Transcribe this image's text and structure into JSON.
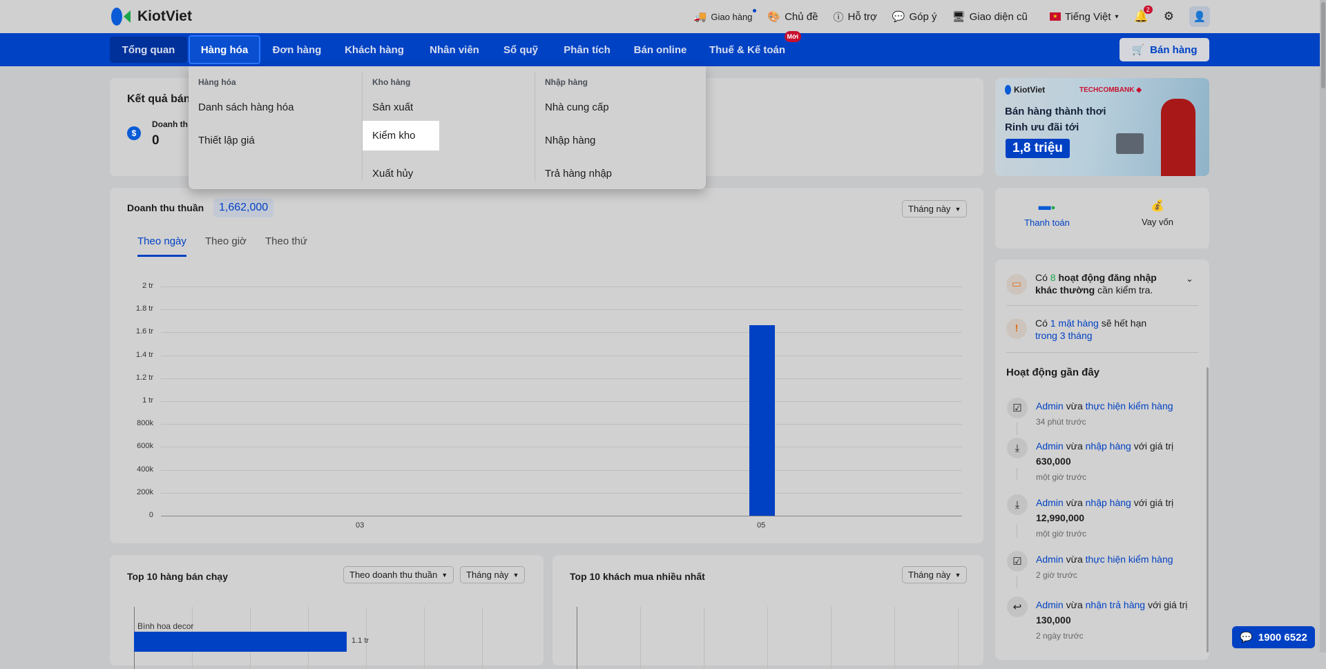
{
  "header": {
    "brand": "KiotViet",
    "links": [
      {
        "label": "Giao hàng",
        "icon": "truck-icon"
      },
      {
        "label": "Chủ đề",
        "icon": "palette-icon"
      },
      {
        "label": "Hỗ trợ",
        "icon": "help-icon"
      },
      {
        "label": "Góp ý",
        "icon": "feedback-icon"
      },
      {
        "label": "Giao diện cũ",
        "icon": "monitor-icon"
      }
    ],
    "language": "Tiếng Việt",
    "notification_count": "2"
  },
  "nav": {
    "items": [
      "Tổng quan",
      "Hàng hóa",
      "Đơn hàng",
      "Khách hàng",
      "Nhân viên",
      "Sổ quỹ",
      "Phân tích",
      "Bán online",
      "Thuế & Kế toán"
    ],
    "new_badge": "Mới",
    "sell_button": "Bán hàng"
  },
  "dropdown": {
    "columns": [
      {
        "title": "Hàng hóa",
        "items": [
          "Danh sách hàng hóa",
          "Thiết lập giá"
        ]
      },
      {
        "title": "Kho hàng",
        "items": [
          "Sản xuất",
          "Kiểm kho",
          "Xuất hủy"
        ]
      },
      {
        "title": "Nhập hàng",
        "items": [
          "Nhà cung cấp",
          "Nhập hàng",
          "Trả hàng nhập"
        ]
      }
    ],
    "hovered": "Kiểm kho"
  },
  "sales_result": {
    "title": "Kết quả bán",
    "metric_label": "Doanh th",
    "metric_value": "0"
  },
  "revenue": {
    "title": "Doanh thu thuần",
    "total": "1,662,000",
    "period": "Tháng này",
    "tabs": [
      "Theo ngày",
      "Theo giờ",
      "Theo thứ"
    ],
    "active_tab": "Theo ngày"
  },
  "chart_data": [
    {
      "type": "bar",
      "title": "Doanh thu thuần",
      "categories": [
        "03",
        "05"
      ],
      "values": [
        0,
        1662000
      ],
      "yticks": [
        "0",
        "200k",
        "400k",
        "600k",
        "800k",
        "1 tr",
        "1.2 tr",
        "1.4 tr",
        "1.6 tr",
        "1.8 tr",
        "2 tr"
      ],
      "ylim": [
        0,
        2000000
      ],
      "color": "#0041c4",
      "grid": true
    },
    {
      "type": "bar",
      "orientation": "horizontal",
      "title": "Top 10 hàng bán chạy",
      "categories": [
        "Bình hoa decor"
      ],
      "values": [
        1100000
      ],
      "value_labels": [
        "1.1 tr"
      ],
      "xlim": [
        0,
        1800000
      ]
    }
  ],
  "top_products": {
    "title": "Top 10 hàng bán chạy",
    "sort": "Theo doanh thu thuần",
    "period": "Tháng này"
  },
  "top_customers": {
    "title": "Top 10 khách mua nhiều nhất",
    "period": "Tháng này"
  },
  "banner": {
    "brand1": "KiotViet",
    "brand2": "TECHCOMBANK",
    "line1": "Bán hàng thành thơi",
    "line2": "Rinh ưu đãi tới",
    "amount": "1,8 triệu"
  },
  "quick": [
    {
      "label": "Thanh toán"
    },
    {
      "label": "Vay vốn"
    }
  ],
  "alerts": {
    "login": {
      "pre": "Có",
      "count": "8",
      "bold1": "hoạt động đăng nhập",
      "bold2": "khác thường",
      "post": "cần kiểm tra."
    },
    "expiry": {
      "pre": "Có",
      "link": "1 mặt hàng",
      "mid": "sẽ hết hạn",
      "link2": "trong 3 tháng"
    }
  },
  "activity": {
    "title": "Hoạt động gần đây",
    "items": [
      {
        "user": "Admin",
        "verb": "vừa",
        "action": "thực hiện kiểm hàng",
        "suffix": "",
        "value": "",
        "time": "34 phút trước",
        "icon": "stock-check-icon"
      },
      {
        "user": "Admin",
        "verb": "vừa",
        "action": "nhập hàng",
        "suffix": "với giá trị",
        "value": "630,000",
        "time": "một giờ trước",
        "icon": "import-icon"
      },
      {
        "user": "Admin",
        "verb": "vừa",
        "action": "nhập hàng",
        "suffix": "với giá trị",
        "value": "12,990,000",
        "time": "một giờ trước",
        "icon": "import-icon"
      },
      {
        "user": "Admin",
        "verb": "vừa",
        "action": "thực hiện kiểm hàng",
        "suffix": "",
        "value": "",
        "time": "2 giờ trước",
        "icon": "stock-check-icon"
      },
      {
        "user": "Admin",
        "verb": "vừa",
        "action": "nhận trả hàng",
        "suffix": "với giá trị",
        "value": "130,000",
        "time": "2 ngày trước",
        "icon": "return-icon"
      }
    ]
  },
  "hotline": "1900 6522"
}
